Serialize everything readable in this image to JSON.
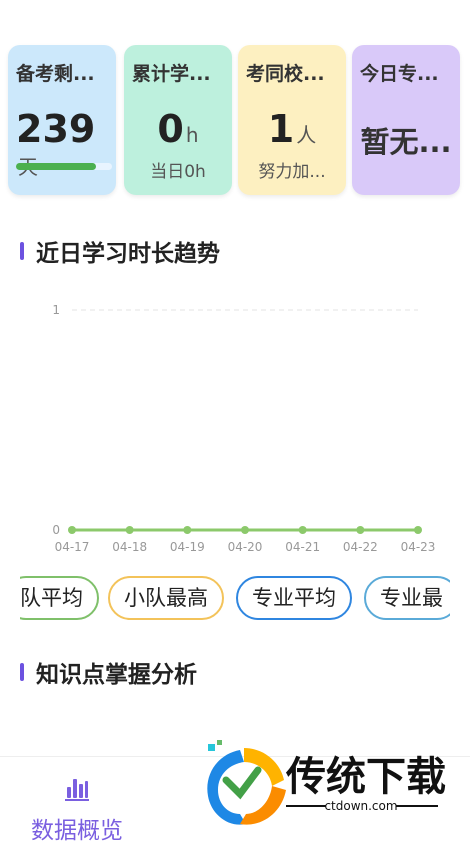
{
  "cards": [
    {
      "title": "备考剩...",
      "value": "239",
      "unit": "天",
      "progress": 0.83,
      "color": "#cce8fb"
    },
    {
      "title": "累计学...",
      "value": "0",
      "unit": "h",
      "sub": "当日0h",
      "color": "#bdf0dd"
    },
    {
      "title": "考同校...",
      "value": "1",
      "unit": "人",
      "sub": "努力加...",
      "color": "#fdf0c1"
    },
    {
      "title": "今日专...",
      "value": "暂无...",
      "color": "#d9c9f9"
    }
  ],
  "sections": {
    "trend_title": "近日学习时长趋势",
    "knowledge_title": "知识点掌握分析"
  },
  "chart_data": {
    "type": "line",
    "categories": [
      "04-17",
      "04-18",
      "04-19",
      "04-20",
      "04-21",
      "04-22",
      "04-23"
    ],
    "series": [
      {
        "values": [
          0,
          0,
          0,
          0,
          0,
          0,
          0
        ]
      }
    ],
    "title": "",
    "xlabel": "",
    "ylabel": "",
    "ylim": [
      0,
      1
    ],
    "yticks": [
      "0",
      "1"
    ],
    "grid": true,
    "colors": {
      "line": "#8cc96b",
      "point": "#8cc96b",
      "grid": "#e3e3e3"
    }
  },
  "pills": [
    {
      "label": "队平均",
      "color": "#7fc06a"
    },
    {
      "label": "小队最高",
      "color": "#f3c35a"
    },
    {
      "label": "专业平均",
      "color": "#2f86e0"
    },
    {
      "label": "专业最",
      "color": "#5aaad8"
    }
  ],
  "bottom_nav": {
    "overview_label": "数据概览",
    "icon": "bar-chart-icon",
    "accent": "#7a5fe0"
  },
  "watermark": {
    "brand": "传统下载",
    "domain": "ctdown.com"
  }
}
